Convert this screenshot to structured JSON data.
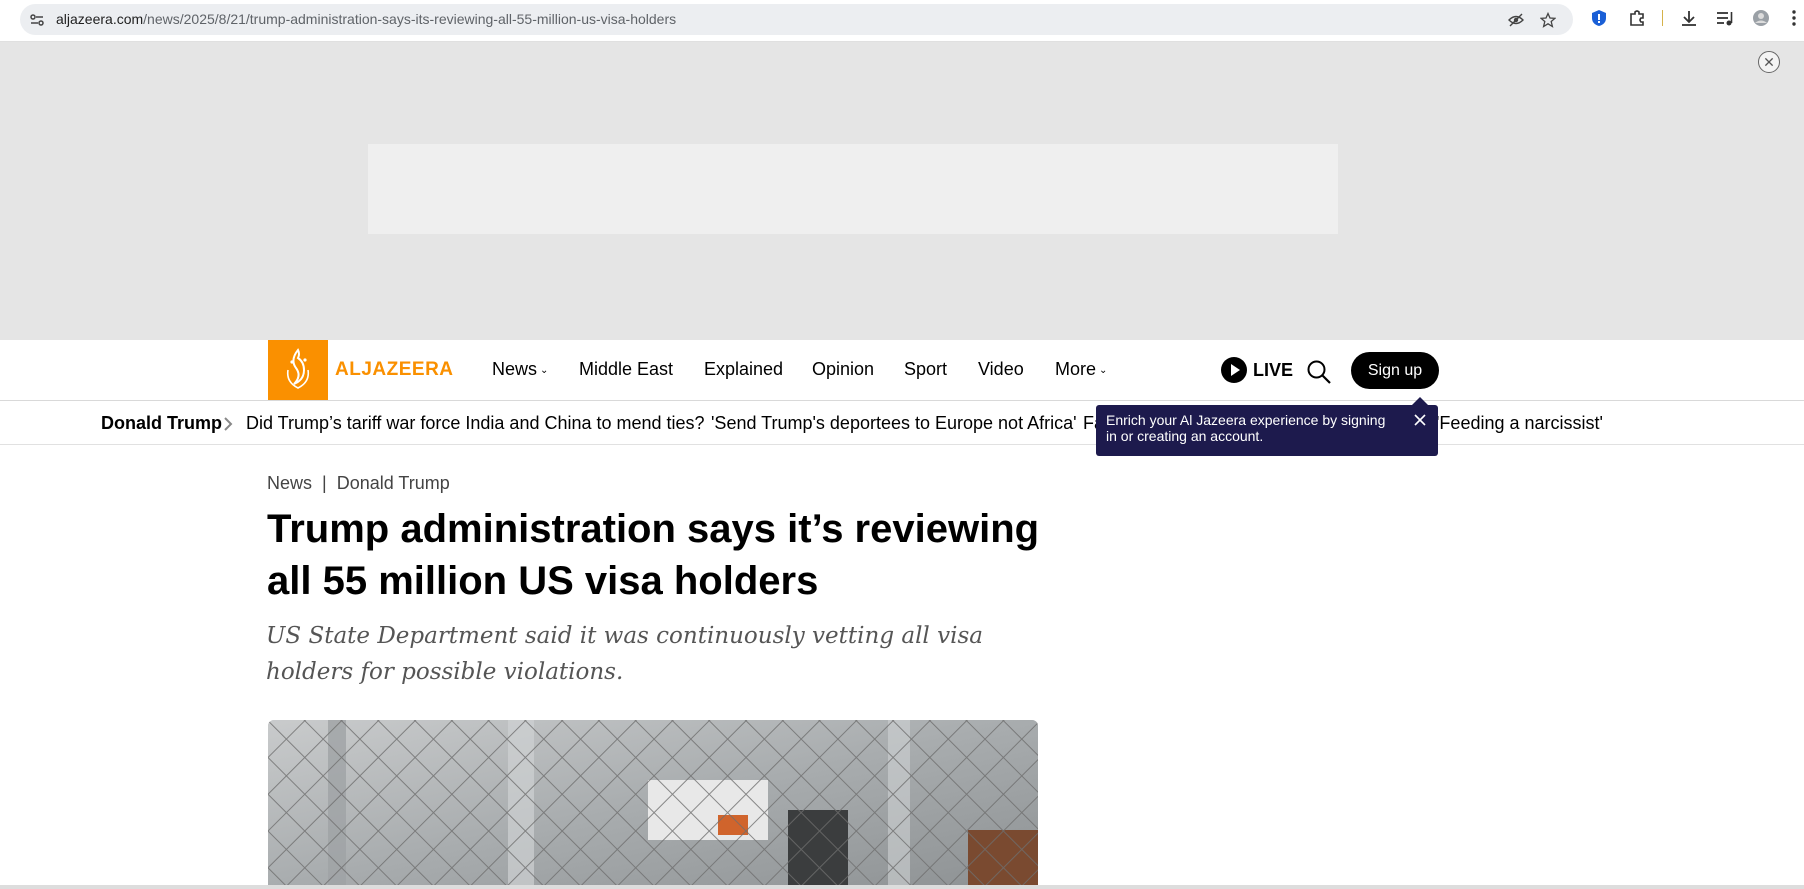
{
  "browser": {
    "url_host": "aljazeera.com",
    "url_path": "/news/2025/8/21/trump-administration-says-its-reviewing-all-55-million-us-visa-holders",
    "icons": [
      "tune-icon",
      "eye-off-icon",
      "star-icon",
      "shield-icon",
      "puzzle-icon",
      "download-icon",
      "media-control-icon",
      "profile-icon",
      "kebab-menu-icon"
    ]
  },
  "header": {
    "logo_text": "ALJAZEERA",
    "nav": [
      "News",
      "Middle East",
      "Explained",
      "Opinion",
      "Sport",
      "Video",
      "More"
    ],
    "live_label": "LIVE",
    "signup_label": "Sign up"
  },
  "ticker": {
    "topic": "Donald Trump",
    "links": [
      "Did Trump’s tariff war force India and China to mend ties?",
      "'Send Trump's deportees to Europe not Africa'",
      "Fa",
      "'Feeding a narcissist'"
    ]
  },
  "tooltip": {
    "text": "Enrich your Al Jazeera experience by signing in or creating an account."
  },
  "article": {
    "section": "News",
    "topic": "Donald Trump",
    "headline": "Trump administration says it’s reviewing all 55 million US visa holders",
    "standfirst": "US State Department said it was continuously vetting all visa holders for possible violations."
  },
  "colors": {
    "brand_orange": "#fa9000",
    "tooltip_bg": "#1d1a4d",
    "ad_bg": "#e5e5e5"
  }
}
